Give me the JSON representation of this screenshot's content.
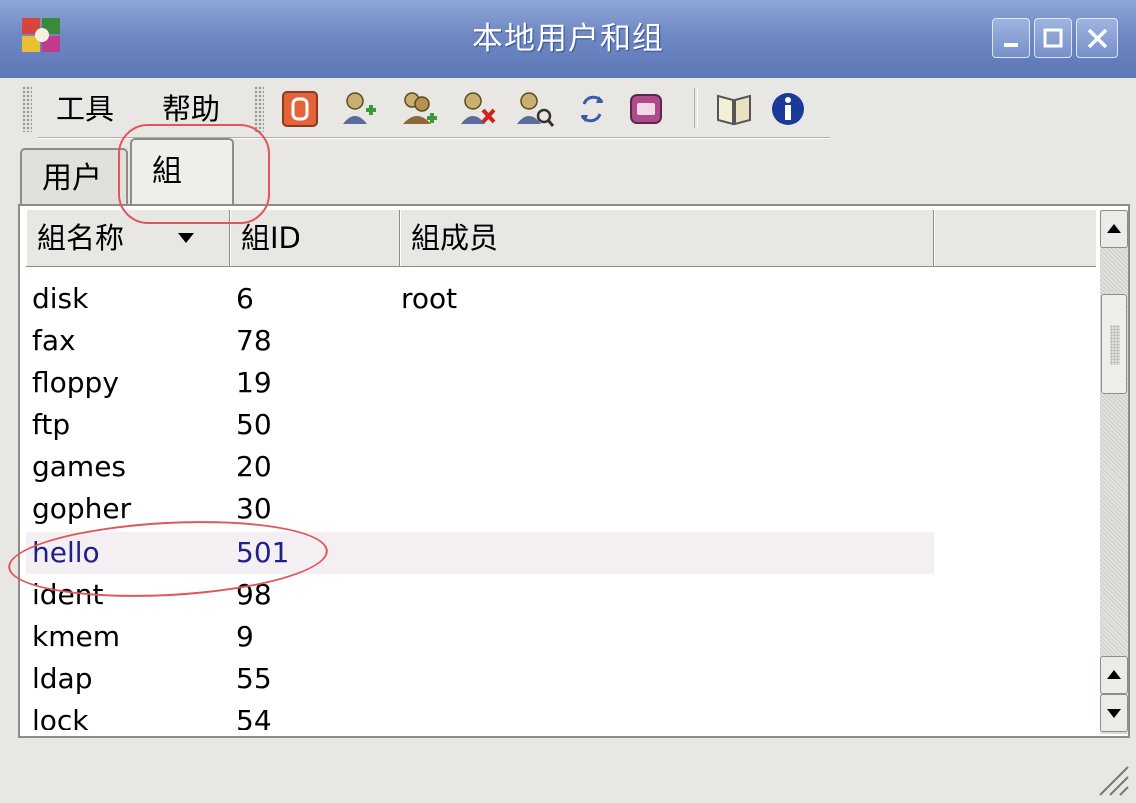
{
  "window": {
    "title": "本地用户和组",
    "app_icon": "users-groups-app-icon",
    "controls": [
      "minimize-icon",
      "maximize-icon",
      "close-icon"
    ],
    "title_color": "#6f88c4"
  },
  "menubar": {
    "items": [
      {
        "label": "工具"
      },
      {
        "label": "帮助"
      }
    ]
  },
  "toolbar": {
    "icons": [
      "quit-icon",
      "add-user-icon",
      "add-group-icon",
      "delete-icon",
      "properties-icon",
      "refresh-icon",
      "preferences-icon",
      "help-book-icon",
      "info-icon"
    ]
  },
  "tabs": [
    {
      "label": "用户",
      "selected": false
    },
    {
      "label": "組",
      "selected": true
    }
  ],
  "table": {
    "columns": [
      "組名称",
      "組ID",
      "組成员",
      ""
    ],
    "sort_column": "組名称",
    "rows": [
      {
        "name": "disk",
        "gid": "6",
        "members": "root"
      },
      {
        "name": "fax",
        "gid": "78",
        "members": ""
      },
      {
        "name": "floppy",
        "gid": "19",
        "members": ""
      },
      {
        "name": "ftp",
        "gid": "50",
        "members": ""
      },
      {
        "name": "games",
        "gid": "20",
        "members": ""
      },
      {
        "name": "gopher",
        "gid": "30",
        "members": ""
      },
      {
        "name": "hello",
        "gid": "501",
        "members": "",
        "highlighted": true
      },
      {
        "name": "ident",
        "gid": "98",
        "members": ""
      },
      {
        "name": "kmem",
        "gid": "9",
        "members": ""
      },
      {
        "name": "ldap",
        "gid": "55",
        "members": ""
      },
      {
        "name": "lock",
        "gid": "54",
        "members": ""
      }
    ]
  },
  "annotations": {
    "color": "#e0565b"
  }
}
